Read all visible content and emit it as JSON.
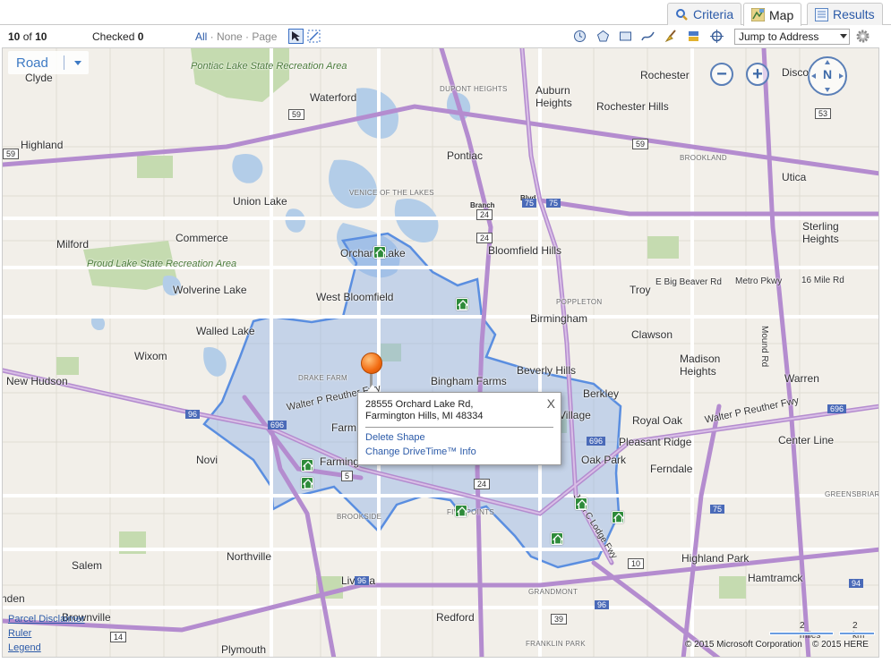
{
  "tabs": [
    {
      "label": "Criteria",
      "icon": "search-icon"
    },
    {
      "label": "Map",
      "icon": "map-icon",
      "active": true
    },
    {
      "label": "Results",
      "icon": "list-icon"
    }
  ],
  "toolbar": {
    "count_current": "10",
    "count_of": "of",
    "count_total": "10",
    "checked_label": "Checked",
    "checked_value": "0",
    "select_all": "All",
    "select_none": "None",
    "select_page": "Page",
    "jump_value": "Jump to Address"
  },
  "map_style": "Road",
  "popup": {
    "address_line1": "28555 Orchard Lake Rd,",
    "address_line2": "Farmington Hills, MI 48334",
    "close": "X",
    "delete": "Delete Shape",
    "change": "Change DriveTime™ Info"
  },
  "compass_label": "N",
  "bottom_links": [
    "Parcel Disclaimer",
    "Ruler",
    "Legend"
  ],
  "scale": {
    "miles": "2 miles",
    "km": "2 km"
  },
  "copyright": {
    "microsoft": "© 2015 Microsoft Corporation",
    "here": "© 2015 HERE"
  },
  "places": [
    {
      "name": "Clyde"
    },
    {
      "name": "Waterford"
    },
    {
      "name": "Rochester"
    },
    {
      "name": "Disco"
    },
    {
      "name": "Auburn Heights"
    },
    {
      "name": "Rochester Hills"
    },
    {
      "name": "Highland"
    },
    {
      "name": "Pontiac"
    },
    {
      "name": "Utica"
    },
    {
      "name": "Union Lake"
    },
    {
      "name": "Commerce"
    },
    {
      "name": "Milford"
    },
    {
      "name": "Bloomfield Hills"
    },
    {
      "name": "Sterling Heights"
    },
    {
      "name": "Orchard Lake"
    },
    {
      "name": "West Bloomfield"
    },
    {
      "name": "Wolverine Lake"
    },
    {
      "name": "Troy"
    },
    {
      "name": "Birmingham"
    },
    {
      "name": "Walled Lake"
    },
    {
      "name": "Wixom"
    },
    {
      "name": "Clawson"
    },
    {
      "name": "Madison Heights"
    },
    {
      "name": "Beverly Hills"
    },
    {
      "name": "Bingham Farms"
    },
    {
      "name": "Warren"
    },
    {
      "name": "New Hudson"
    },
    {
      "name": "Berkley"
    },
    {
      "name": "Royal Oak"
    },
    {
      "name": "Pleasant Ridge"
    },
    {
      "name": "Center Line"
    },
    {
      "name": "Novi"
    },
    {
      "name": "Oak Park"
    },
    {
      "name": "Ferndale"
    },
    {
      "name": "Northville"
    },
    {
      "name": "Salem"
    },
    {
      "name": "Livonia"
    },
    {
      "name": "Highland Park"
    },
    {
      "name": "Hamtramck"
    },
    {
      "name": "Redford"
    },
    {
      "name": "Plymouth"
    },
    {
      "name": "Brownville"
    }
  ],
  "parks": [
    {
      "name": "Pontiac Lake State Recreation Area"
    },
    {
      "name": "Proud Lake State Recreation Area"
    }
  ],
  "districts": [
    "DUPONT HEIGHTS",
    "VENICE OF THE LAKES",
    "POPPLETON",
    "BROOKLAND",
    "DRAKE FARM",
    "BROOKSIDE",
    "FIVE POINTS",
    "GRANDMONT",
    "FRANKLIN PARK",
    "GREENSBRIAR"
  ],
  "roads": [
    "Walter P Reuther Fwy",
    "Walter P Reuther Fwy",
    "E Big Beaver Rd",
    "Metro Pkwy",
    "16 Mile Rd",
    "Mound Rd",
    "John C Lodge Fwy"
  ],
  "shields": [
    "59",
    "59",
    "53",
    "59",
    "24",
    "75",
    "75",
    "96",
    "696",
    "696",
    "696",
    "5",
    "24",
    "10",
    "75",
    "94",
    "96",
    "96",
    "39",
    "14",
    "24"
  ],
  "partial_labels": [
    "Farm",
    "Farming",
    "Village",
    "Branch",
    "Blvd",
    "nden"
  ],
  "colors": {
    "drivetime_fill": "#8fb1e6",
    "drivetime_stroke": "#5a8ee0",
    "freeway": "#b48ccf",
    "major_road": "#ffffff",
    "water": "#b3cde8",
    "park": "#c5dbb0",
    "pin": "#f26a10",
    "listing_marker": "#2e8b3a",
    "link": "#2b5aa8"
  }
}
